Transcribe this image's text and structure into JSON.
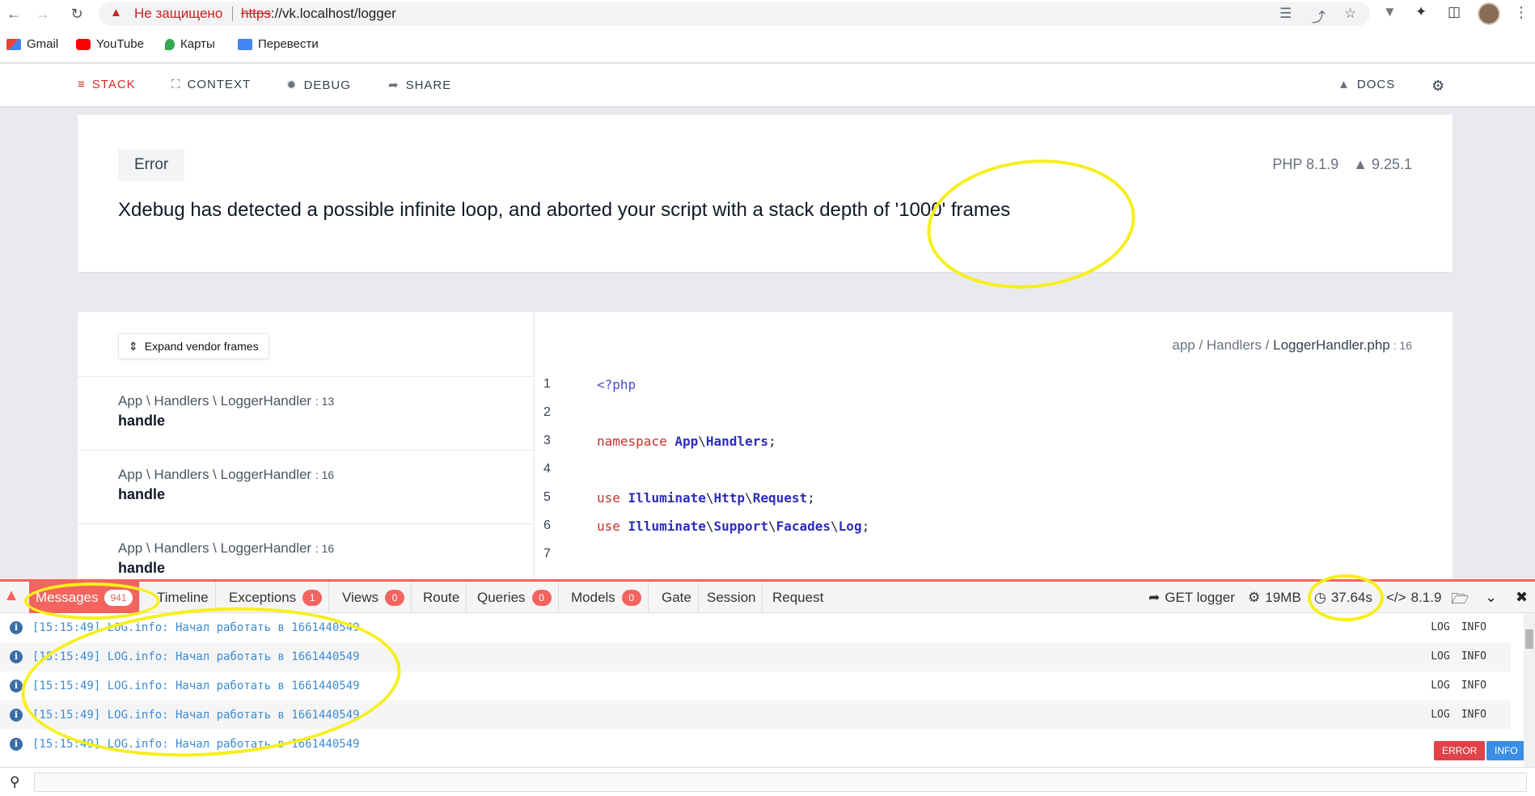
{
  "browser": {
    "not_secure": "Не защищено",
    "url_scheme": "https",
    "url_rest": "://vk.localhost/logger",
    "bookmarks": [
      "Gmail",
      "YouTube",
      "Карты",
      "Перевести"
    ]
  },
  "ignition_nav": {
    "tabs": [
      {
        "label": "STACK",
        "icon": "stack-icon",
        "active": true
      },
      {
        "label": "CONTEXT",
        "icon": "context-icon",
        "active": false
      },
      {
        "label": "DEBUG",
        "icon": "bug-icon",
        "active": false
      },
      {
        "label": "SHARE",
        "icon": "share-icon",
        "active": false
      }
    ],
    "docs": "DOCS"
  },
  "error": {
    "type": "Error",
    "message": "Xdebug has detected a possible infinite loop, and aborted your script with a stack depth of '1000' frames",
    "php_version": "PHP 8.1.9",
    "laravel_version": "9.25.1"
  },
  "stack": {
    "expand_label": "Expand vendor frames",
    "frames": [
      {
        "path": "App \\ Handlers \\ LoggerHandler",
        "line": ": 13",
        "function": "handle"
      },
      {
        "path": "App \\ Handlers \\ LoggerHandler",
        "line": ": 16",
        "function": "handle"
      },
      {
        "path": "App \\ Handlers \\ LoggerHandler",
        "line": ": 16",
        "function": "handle"
      }
    ],
    "file": {
      "dir": "app / Handlers / ",
      "name": "LoggerHandler.php",
      "line": " : 16"
    },
    "code_numbers": [
      "1",
      "2",
      "3",
      "4",
      "5",
      "6",
      "7"
    ]
  },
  "debugbar": {
    "tabs": [
      {
        "label": "Messages",
        "badge": "941",
        "active": true
      },
      {
        "label": "Timeline",
        "badge": null
      },
      {
        "label": "Exceptions",
        "badge": "1"
      },
      {
        "label": "Views",
        "badge": "0"
      },
      {
        "label": "Route",
        "badge": null
      },
      {
        "label": "Queries",
        "badge": "0"
      },
      {
        "label": "Models",
        "badge": "0"
      },
      {
        "label": "Gate",
        "badge": null
      },
      {
        "label": "Session",
        "badge": null
      },
      {
        "label": "Request",
        "badge": null
      }
    ],
    "request": "GET logger",
    "memory": "19MB",
    "time": "37.64s",
    "php": "8.1.9",
    "messages": [
      {
        "text": "[15:15:49] LOG.info: Начал работать в 1661440549",
        "label": "LOG",
        "level": "INFO"
      },
      {
        "text": "[15:15:49] LOG.info: Начал работать в 1661440549",
        "label": "LOG",
        "level": "INFO"
      },
      {
        "text": "[15:15:49] LOG.info: Начал работать в 1661440549",
        "label": "LOG",
        "level": "INFO"
      },
      {
        "text": "[15:15:49] LOG.info: Начал работать в 1661440549",
        "label": "LOG",
        "level": "INFO"
      },
      {
        "text": "[15:15:49] LOG.info: Начал работать в 1661440549",
        "label": "",
        "level": ""
      }
    ],
    "filters": [
      {
        "label": "ERROR",
        "color": "#e0434a"
      },
      {
        "label": "INFO",
        "color": "#3a8ee6"
      }
    ]
  },
  "colors": {
    "accent": "#dc2626",
    "debugbar": "#f4645f",
    "highlight": "#f6ef1b"
  }
}
